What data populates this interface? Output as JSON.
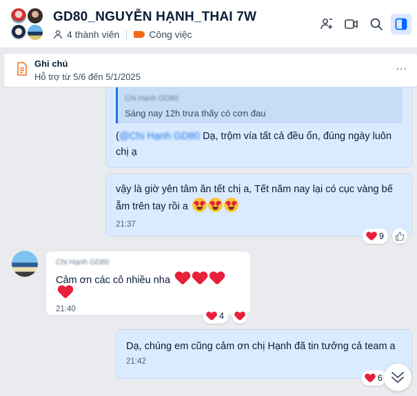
{
  "header": {
    "title": "GD80_NGUYỄN HẠNH_THAI 7W",
    "members": "4 thành viên",
    "tag": "Công việc",
    "tag_color": "#f26a1b",
    "icons": [
      "add-member-icon",
      "video-call-icon",
      "search-icon",
      "toggle-sidebar-icon"
    ]
  },
  "pinned_note": {
    "title": "Ghi chú",
    "subtitle": "Hỗ trợ từ 5/6 đến 5/1/2025",
    "more": "..."
  },
  "messages": [
    {
      "quote_sender": "Chị Hạnh GD80",
      "quote_text": "Sáng nay 12h trưa thấy có cơn đau",
      "mention_prefix": "(",
      "mention": "@Chị Hạnh GD80",
      "text": "Dạ, trộm vía tất cả đều ổn, đúng ngày luôn chị ạ"
    },
    {
      "text": "vậy là giờ yên tâm ăn tết chị a, Tết năm nay lại có cục vàng bế ẵm trên tay rồi a",
      "time": "21:37",
      "reaction_count": "9"
    },
    {
      "sender": "Chị Hạnh GD80",
      "text": "Cảm ơn các cô nhiều nha",
      "time": "21:40",
      "reaction_count": "4"
    },
    {
      "text": "Dạ, chúng em cũng cảm ơn chị Hạnh đã tin tưởng cả team a",
      "time": "21:42",
      "reaction_count": "6"
    }
  ],
  "colors": {
    "accent": "#1a73e8",
    "outgoing_bubble": "#dbebff",
    "incoming_bubble": "#ffffff",
    "background": "#e9ebee",
    "heart": "#e8203a"
  }
}
